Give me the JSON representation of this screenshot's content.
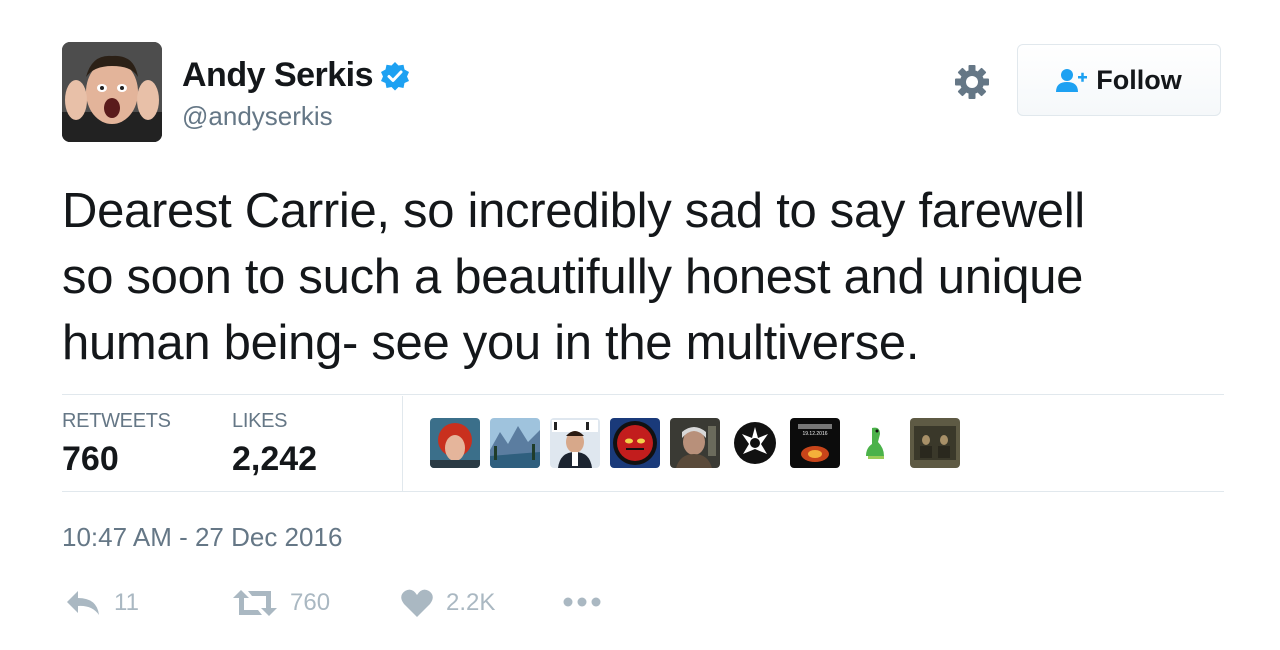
{
  "author": {
    "name": "Andy Serkis",
    "handle": "@andyserkis",
    "verified_icon": "verified-badge-icon"
  },
  "header_actions": {
    "settings_icon": "gear-icon",
    "follow_label": "Follow",
    "follow_icon": "add-user-icon"
  },
  "tweet": {
    "lines": [
      "Dearest Carrie, so incredibly sad to say farewell",
      "so soon to such a beautifully honest and unique",
      "human being- see you in the multiverse."
    ]
  },
  "stats": {
    "retweets_label": "RETWEETS",
    "retweets_value": "760",
    "likes_label": "LIKES",
    "likes_value": "2,242"
  },
  "liked_by": {
    "count_shown": 9,
    "badge_text": "19.12.2016"
  },
  "timestamp": "10:47 AM - 27 Dec 2016",
  "actions": {
    "reply_count": "11",
    "retweet_count": "760",
    "like_count": "2.2K",
    "more_icon": "more-dots-icon"
  },
  "colors": {
    "text": "#14171a",
    "muted": "#657786",
    "action_gray": "#aab8c2",
    "verified_blue": "#1da1f2",
    "divider": "#e1e8ed"
  }
}
